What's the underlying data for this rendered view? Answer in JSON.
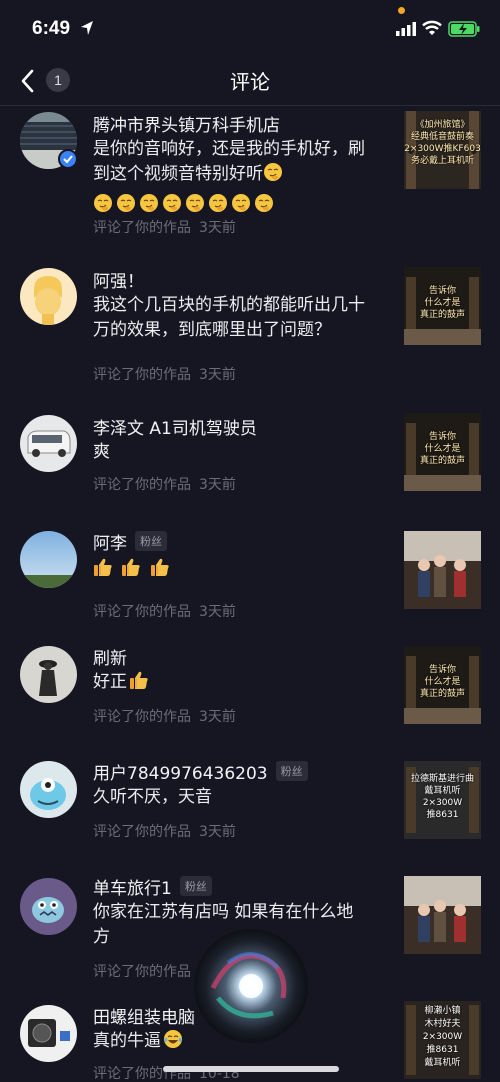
{
  "status_bar": {
    "time": "6:49"
  },
  "header": {
    "back_count": "1",
    "title": "评论"
  },
  "colors": {
    "background": "#161622",
    "meta_text": "#6c6c78",
    "verified": "#3b82f6",
    "fan_tag_bg": "#2c2c38"
  },
  "icons": [
    "location-arrow-icon",
    "signal-icon",
    "wifi-icon",
    "battery-charging-icon",
    "back-chevron-icon",
    "verified-icon",
    "thumbs-up-emoji",
    "smirk-emoji",
    "tears-of-joy-emoji",
    "siri-icon"
  ],
  "comments": [
    {
      "username": "腾冲市界头镇万科手机店",
      "fan_tag": "",
      "comment": "是你的音响好，还是我的手机好，刷到这个视频音特别好听",
      "meta_action": "评论了你的作品",
      "meta_time": "3天前",
      "thumb_text": "《加州旅馆》\n经典低音鼓前奏\n2×300W推KF603\n务必戴上耳机听"
    },
    {
      "username": "阿强！",
      "fan_tag": "",
      "comment": "我这个几百块的手机的都能听出几十万的效果，到底哪里出了问题？",
      "meta_action": "评论了你的作品",
      "meta_time": "3天前",
      "thumb_text": "告诉你\n什么才是\n真正的鼓声"
    },
    {
      "username": "李泽文 A1司机驾驶员",
      "fan_tag": "",
      "comment": "爽",
      "meta_action": "评论了你的作品",
      "meta_time": "3天前",
      "thumb_text": "告诉你\n什么才是\n真正的鼓声"
    },
    {
      "username": "阿李",
      "fan_tag": "粉丝",
      "comment": "",
      "meta_action": "评论了你的作品",
      "meta_time": "3天前",
      "thumb_text": ""
    },
    {
      "username": "刷新",
      "fan_tag": "",
      "comment": "好正",
      "meta_action": "评论了你的作品",
      "meta_time": "3天前",
      "thumb_text": "告诉你\n什么才是\n真正的鼓声"
    },
    {
      "username": "用户7849976436203",
      "fan_tag": "粉丝",
      "comment": "久听不厌，天音",
      "meta_action": "评论了你的作品",
      "meta_time": "3天前",
      "thumb_text": "拉德斯基进行曲\n戴耳机听\n2×300W\n推8631"
    },
    {
      "username": "单车旅行1",
      "fan_tag": "粉丝",
      "comment": "你家在江苏有店吗 如果有在什么地方",
      "meta_action": "评论了你的作品",
      "meta_time": "",
      "thumb_text": ""
    },
    {
      "username": "田螺组装电脑",
      "fan_tag": "",
      "comment": "真的牛逼",
      "meta_action": "评论了你的作品",
      "meta_time": "10-18",
      "thumb_text": "柳濑小镇\n木村好夫\n2×300W\n推8631\n戴耳机听"
    }
  ]
}
